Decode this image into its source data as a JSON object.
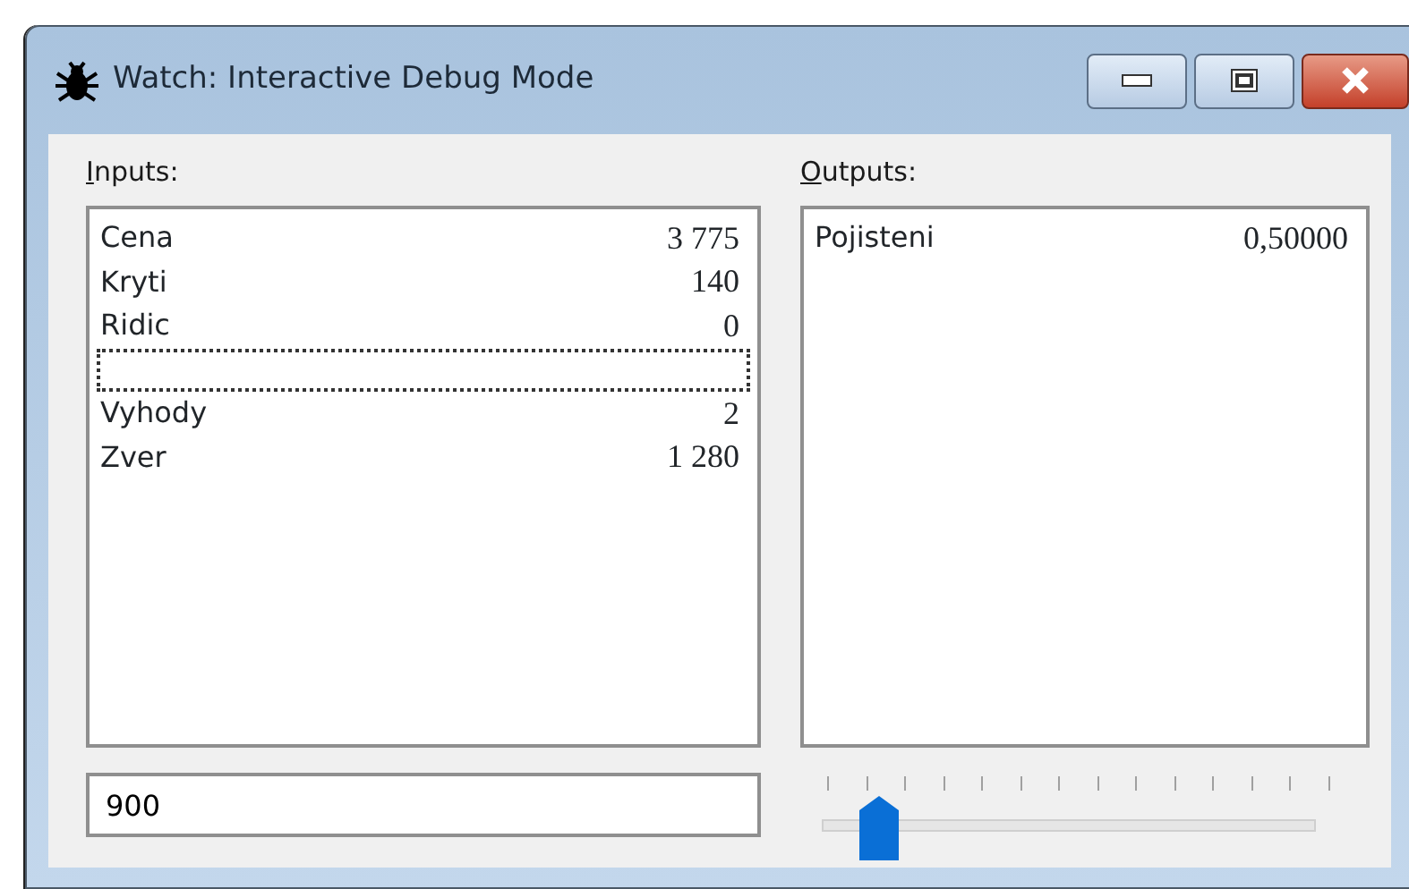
{
  "window": {
    "title": "Watch: Interactive Debug Mode"
  },
  "inputs": {
    "label": "Inputs:",
    "rows": [
      {
        "name": "Cena",
        "value": "3 775",
        "focused": false
      },
      {
        "name": "Kryti",
        "value": "140",
        "focused": false
      },
      {
        "name": "Ridic",
        "value": "0",
        "focused": false
      },
      {
        "focused": true
      },
      {
        "name": "Vyhody",
        "value": "2",
        "focused": false
      },
      {
        "name": "Zver",
        "value": "1 280",
        "focused": false
      }
    ]
  },
  "outputs": {
    "label": "Outputs:",
    "rows": [
      {
        "name": "Pojisteni",
        "value": "0,50000"
      }
    ]
  },
  "value_field": {
    "value": "900"
  },
  "slider": {
    "level": 0.12
  }
}
